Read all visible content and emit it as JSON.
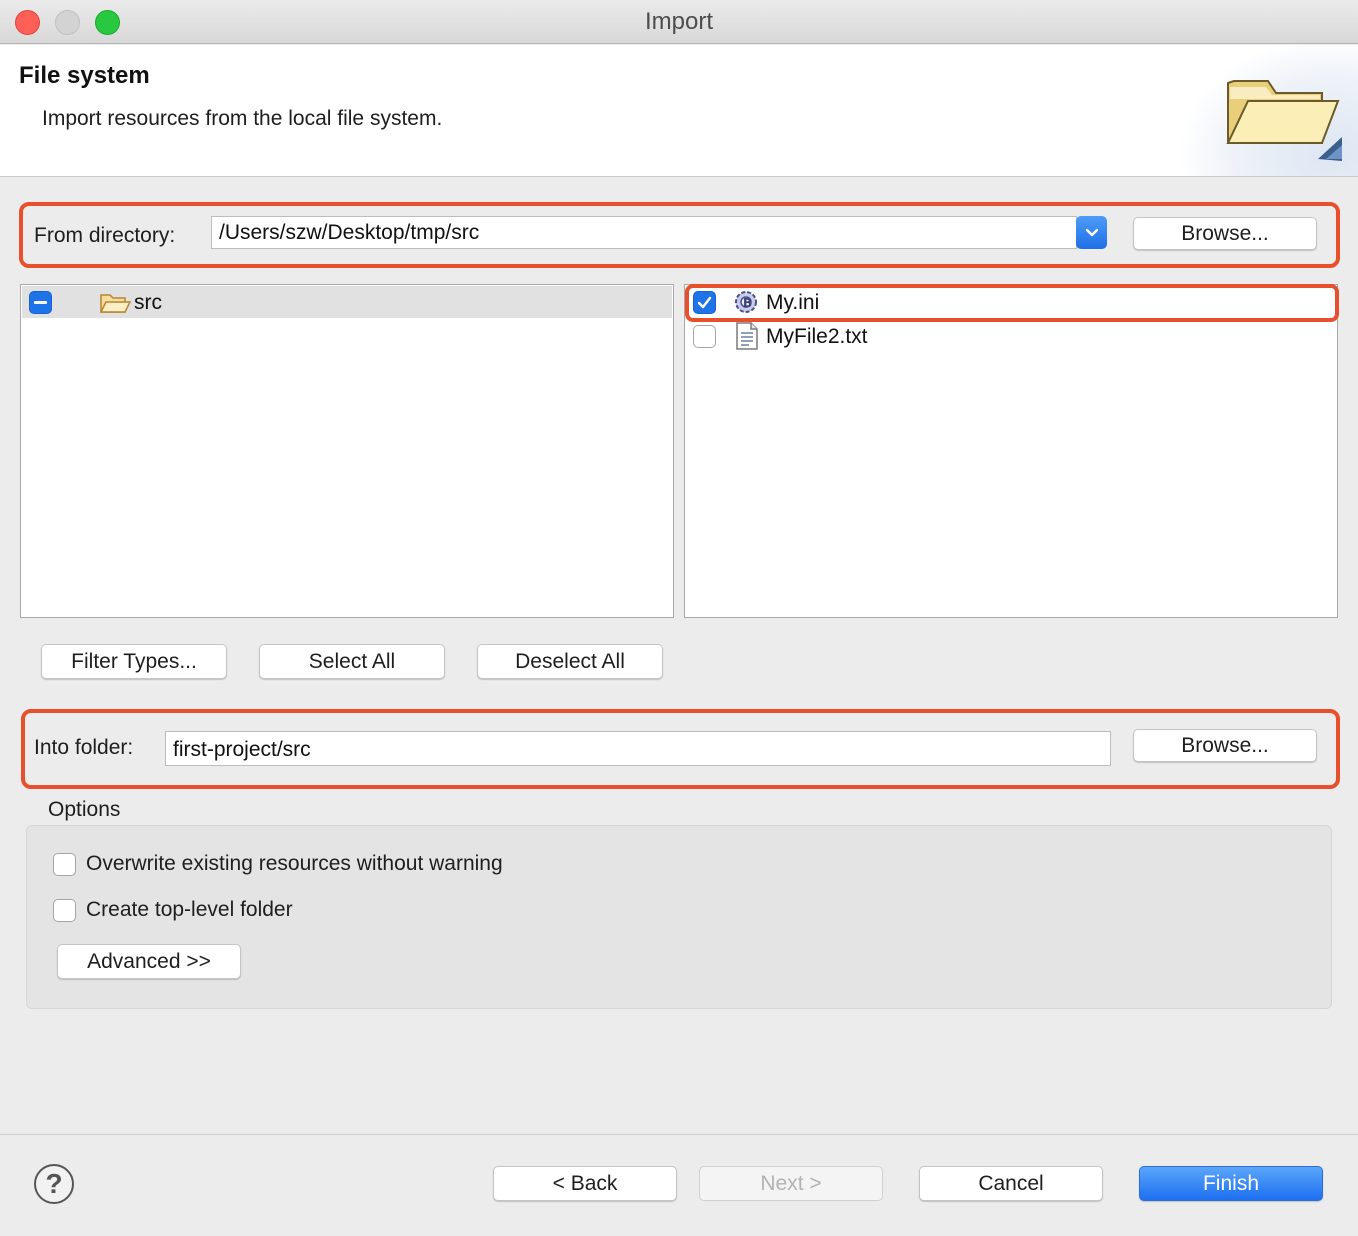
{
  "window": {
    "title": "Import"
  },
  "header": {
    "title": "File system",
    "subtitle": "Import resources from the local file system."
  },
  "from_directory": {
    "label": "From directory:",
    "value": "/Users/szw/Desktop/tmp/src",
    "browse_label": "Browse..."
  },
  "folder_tree": {
    "items": [
      {
        "label": "src",
        "state": "partial"
      }
    ]
  },
  "file_list": {
    "items": [
      {
        "label": "My.ini",
        "checked": true,
        "icon": "ini-settings-icon"
      },
      {
        "label": "MyFile2.txt",
        "checked": false,
        "icon": "text-file-icon"
      }
    ]
  },
  "selection_buttons": {
    "filter_types": "Filter Types...",
    "select_all": "Select All",
    "deselect_all": "Deselect All"
  },
  "into_folder": {
    "label": "Into folder:",
    "value": "first-project/src",
    "browse_label": "Browse..."
  },
  "options": {
    "title": "Options",
    "overwrite_label": "Overwrite existing resources without warning",
    "overwrite_checked": false,
    "top_level_label": "Create top-level folder",
    "top_level_checked": false,
    "advanced_label": "Advanced >>"
  },
  "footer": {
    "help": "?",
    "back": "< Back",
    "next": "Next >",
    "cancel": "Cancel",
    "finish": "Finish"
  },
  "colors": {
    "highlight": "#e8502d",
    "accent": "#1f73e8"
  }
}
